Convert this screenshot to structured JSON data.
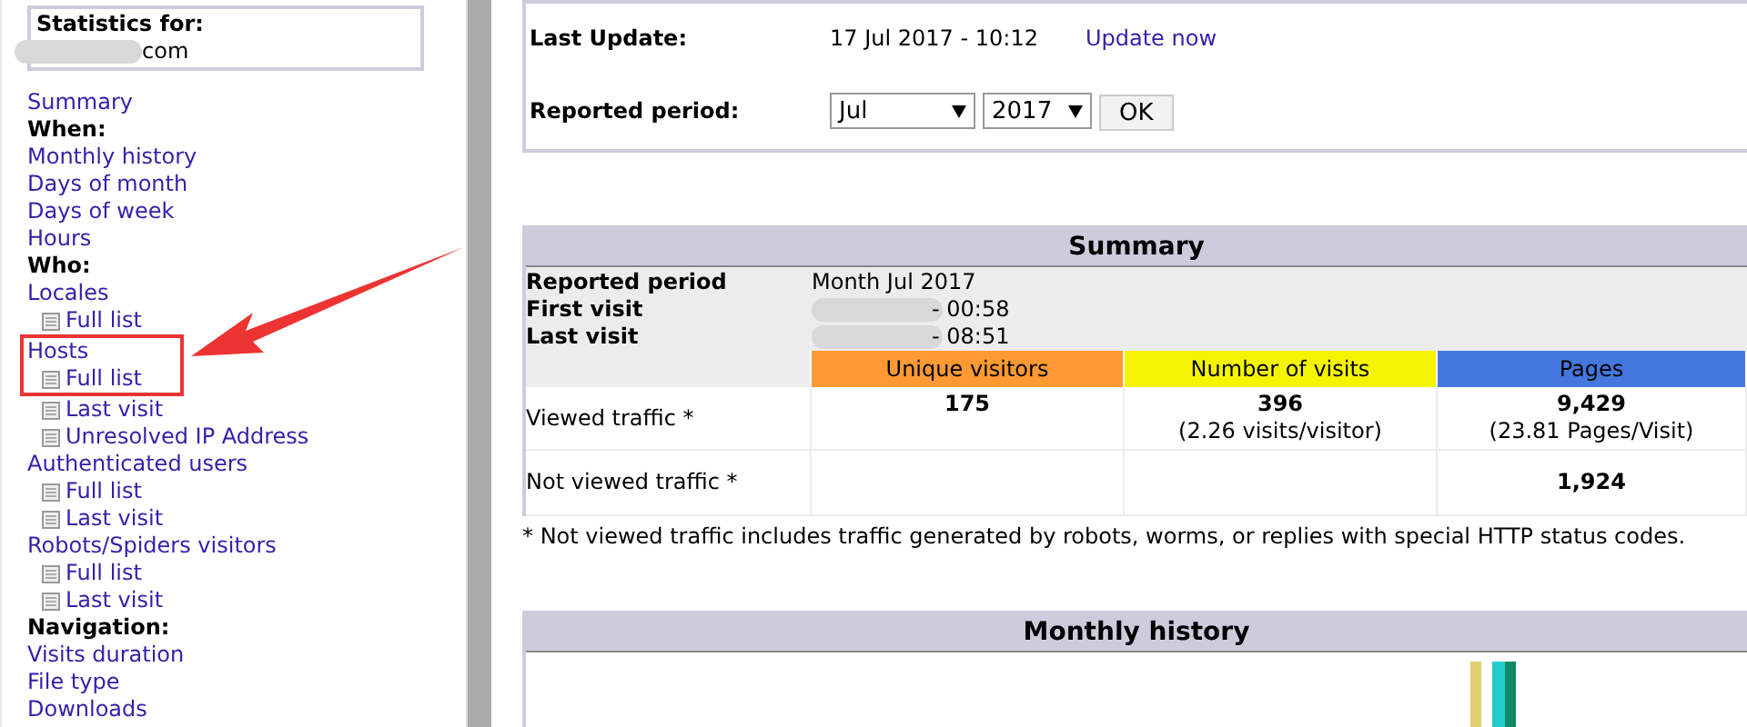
{
  "sidebar": {
    "title": "Statistics for:",
    "domain": "com",
    "menu": [
      {
        "kind": "link",
        "label": "Summary"
      },
      {
        "kind": "heading",
        "label": "When:"
      },
      {
        "kind": "link",
        "label": "Monthly history"
      },
      {
        "kind": "link",
        "label": "Days of month"
      },
      {
        "kind": "link",
        "label": "Days of week"
      },
      {
        "kind": "link",
        "label": "Hours"
      },
      {
        "kind": "heading",
        "label": "Who:"
      },
      {
        "kind": "link",
        "label": "Locales",
        "children": [
          {
            "label": "Full list"
          }
        ]
      },
      {
        "kind": "link",
        "label": "Hosts",
        "highlighted": true,
        "children": [
          {
            "label": "Full list"
          },
          {
            "label": "Last visit"
          },
          {
            "label": "Unresolved IP Address"
          }
        ]
      },
      {
        "kind": "link",
        "label": "Authenticated users",
        "children": [
          {
            "label": "Full list"
          },
          {
            "label": "Last visit"
          }
        ]
      },
      {
        "kind": "link",
        "label": "Robots/Spiders visitors",
        "children": [
          {
            "label": "Full list"
          },
          {
            "label": "Last visit"
          }
        ]
      },
      {
        "kind": "heading",
        "label": "Navigation:"
      },
      {
        "kind": "link",
        "label": "Visits duration"
      },
      {
        "kind": "link",
        "label": "File type"
      },
      {
        "kind": "link",
        "label": "Downloads"
      }
    ]
  },
  "header": {
    "last_update_label": "Last Update:",
    "last_update": "17 Jul 2017 - 10:12",
    "update_link": "Update now",
    "period_label": "Reported period:",
    "month": "Jul",
    "year": "2017",
    "ok_button": "OK"
  },
  "summary": {
    "title": "Summary",
    "info": [
      {
        "label": "Reported period",
        "value": "Month Jul 2017",
        "redacted": false
      },
      {
        "label": "First visit",
        "value": "- 00:58",
        "redacted": true
      },
      {
        "label": "Last visit",
        "value": "- 08:51",
        "redacted": true
      }
    ],
    "columns": [
      {
        "label": "Unique visitors",
        "color": "#ff9933"
      },
      {
        "label": "Number of visits",
        "color": "#f4f400"
      },
      {
        "label": "Pages",
        "color": "#4477dd"
      }
    ],
    "rows": [
      {
        "label": "Viewed traffic *",
        "cells": [
          {
            "value": "175"
          },
          {
            "value": "396",
            "note": "(2.26 visits/visitor)"
          },
          {
            "value": "9,429",
            "note": "(23.81 Pages/Visit)"
          }
        ]
      },
      {
        "label": "Not viewed traffic *",
        "cells": [
          {},
          {},
          {
            "value": "1,924"
          }
        ]
      }
    ],
    "footnote": "* Not viewed traffic includes traffic generated by robots, worms, or replies with special HTTP status codes."
  },
  "monthly": {
    "title": "Monthly history"
  }
}
